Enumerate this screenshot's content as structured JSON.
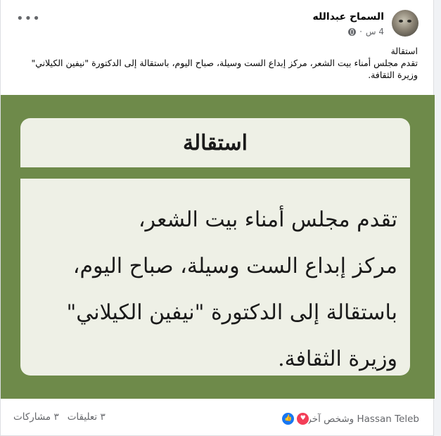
{
  "post": {
    "author": "السماح عبدالله",
    "time": "4 س",
    "separator": "·",
    "caption_title": "استقالة",
    "caption_body": "تقدم مجلس أمناء بيت الشعر، مركز إبداع الست وسيلة، صباح اليوم، باستقالة إلى الدكتورة \"نيفين الكيلاني\" وزيرة الثقافة."
  },
  "image": {
    "title": "استقالة",
    "lines": [
      "تقدم مجلس أمناء بيت الشعر،",
      "مركز إبداع الست وسيلة، صباح اليوم،",
      "باستقالة إلى الدكتورة \"نيفين الكيلاني\"",
      "وزيرة الثقافة."
    ]
  },
  "footer": {
    "reactors": "Hassan Teleb وشخص آخر",
    "comments": "٣ تعليقات",
    "shares": "٣ مشاركات"
  },
  "icons": {
    "more": "more-options-icon",
    "privacy": "globe-icon",
    "like": "like-reaction-icon",
    "love": "love-reaction-icon"
  },
  "colors": {
    "image_background": "#6e8a4a",
    "panel": "#eef0e6",
    "like": "#1877f2",
    "love": "#f33e58"
  }
}
